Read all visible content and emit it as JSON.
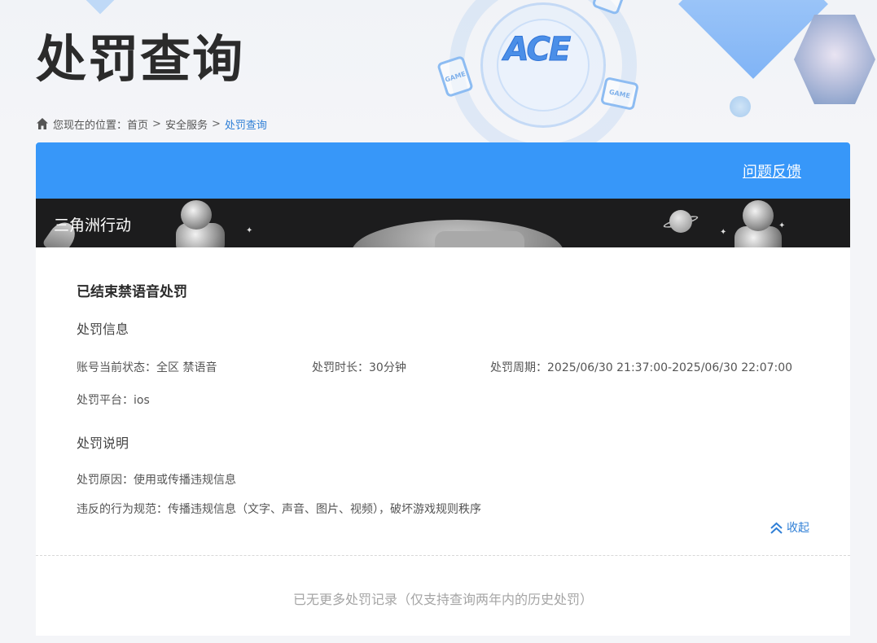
{
  "header": {
    "title": "处罚查询",
    "logo_text": "ACE",
    "chip_label": "GAME"
  },
  "breadcrumb": {
    "prefix": "您现在的位置：",
    "items": [
      "首页",
      "安全服务",
      "处罚查询"
    ],
    "separator": ">"
  },
  "blue_bar": {
    "feedback_label": "问题反馈"
  },
  "game": {
    "name": "三角洲行动"
  },
  "record": {
    "title": "已结束禁语音处罚",
    "info_section": "处罚信息",
    "status": "账号当前状态：全区 禁语音",
    "duration": "处罚时长：30分钟",
    "period": "处罚周期：2025/06/30 21:37:00-2025/06/30 22:07:00",
    "platform": "处罚平台：ios",
    "desc_section": "处罚说明",
    "reason": "处罚原因：使用或传播违规信息",
    "rule": "违反的行为规范：传播违规信息（文字、声音、图片、视频），破坏游戏规则秩序",
    "collapse_label": "收起"
  },
  "footer": {
    "note": "已无更多处罚记录（仅支持查询两年内的历史处罚）"
  },
  "colors": {
    "accent_blue": "#3797f9",
    "link_blue": "#2f7fd6",
    "banner_dark": "#1c1c1d",
    "title_text": "#2b2b2b"
  }
}
